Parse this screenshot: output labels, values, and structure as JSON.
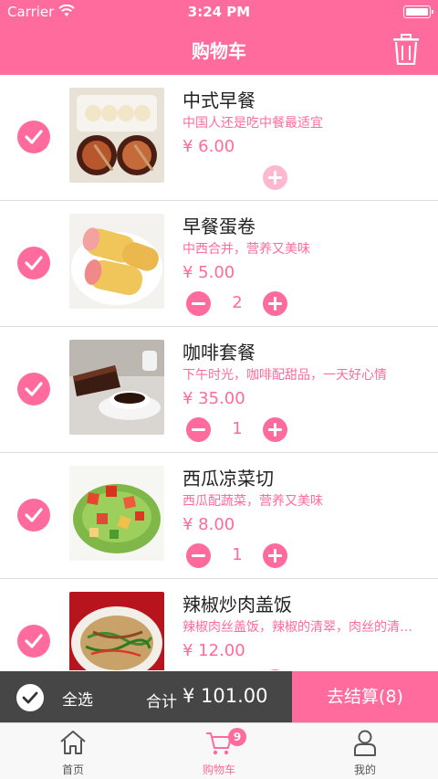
{
  "status_bar": {
    "carrier": "Carrier",
    "time": "3:24 PM"
  },
  "nav": {
    "title": "购物车"
  },
  "items": [
    {
      "name": "中式早餐",
      "desc": "中国人还是吃中餐最适宜",
      "price": "¥ 6.00",
      "qty": ""
    },
    {
      "name": "早餐蛋卷",
      "desc": "中西合并，营养又美味",
      "price": "¥ 5.00",
      "qty": "2"
    },
    {
      "name": "咖啡套餐",
      "desc": "下午时光，咖啡配甜品，一天好心情",
      "price": "¥ 35.00",
      "qty": "1"
    },
    {
      "name": "西瓜凉菜切",
      "desc": "西瓜配蔬菜，营养又美味",
      "price": "¥ 8.00",
      "qty": "1"
    },
    {
      "name": "辣椒炒肉盖饭",
      "desc": "辣椒肉丝盖饭，辣椒的清翠，肉丝的清…",
      "price": "¥ 12.00",
      "qty": ""
    }
  ],
  "bottom_bar": {
    "select_all": "全选",
    "total_label": "合计",
    "total": "¥ 101.00",
    "checkout": "去结算(8)"
  },
  "tabs": [
    {
      "label": "首页"
    },
    {
      "label": "购物车",
      "badge": "9"
    },
    {
      "label": "我的"
    }
  ],
  "colors": {
    "accent": "#ff6b9c",
    "accent_light": "#ffb8cf",
    "bar_dark": "#3c3c3c"
  }
}
